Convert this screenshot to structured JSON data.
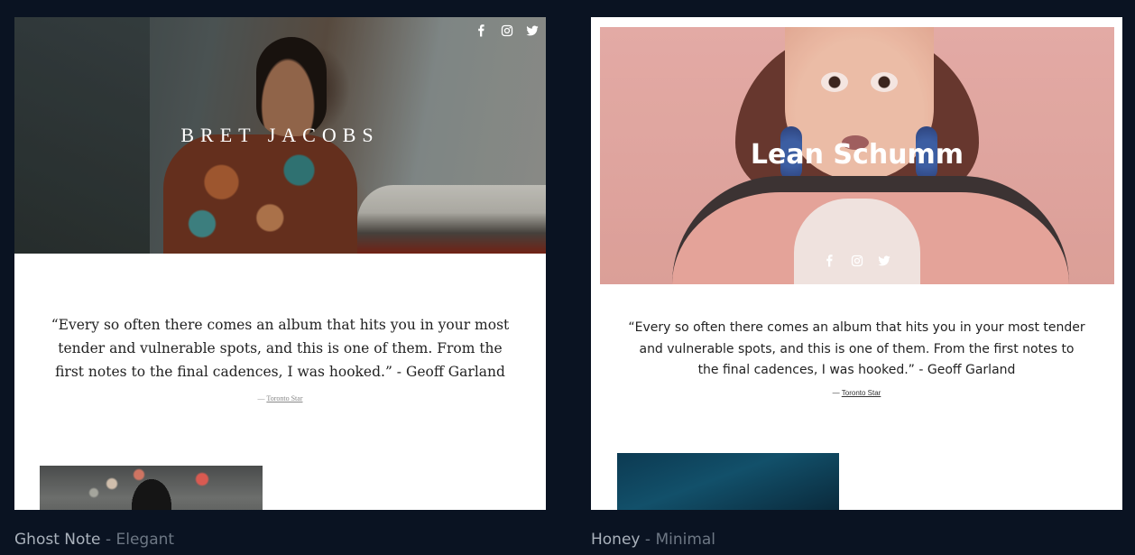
{
  "themes": [
    {
      "artist_name": "BRET JACOBS",
      "quote": "“Every so often there comes an album that hits you in your most tender and vulnerable spots, and this is one of them. From the first notes to the final cadences, I was hooked.” - Geoff Garland",
      "source_dash": "—",
      "source": "Toronto Star",
      "caption_name": "Ghost Note",
      "caption_sep": "-",
      "caption_style": "Elegant",
      "social_icons": [
        "facebook-icon",
        "instagram-icon",
        "twitter-icon"
      ]
    },
    {
      "artist_name": "Lean Schumm",
      "quote": "“Every so often there comes an album that hits you in your most tender and vulnerable spots, and this is one of them. From the first notes to the final cadences, I was hooked.” - Geoff Garland",
      "source_dash": "—",
      "source": "Toronto Star",
      "caption_name": "Honey",
      "caption_sep": "-",
      "caption_style": "Minimal",
      "social_icons": [
        "facebook-icon",
        "instagram-icon",
        "twitter-icon"
      ]
    }
  ],
  "colors": {
    "background": "#0a1322",
    "caption_name": "#aab2bc",
    "caption_style": "#6d7784"
  }
}
